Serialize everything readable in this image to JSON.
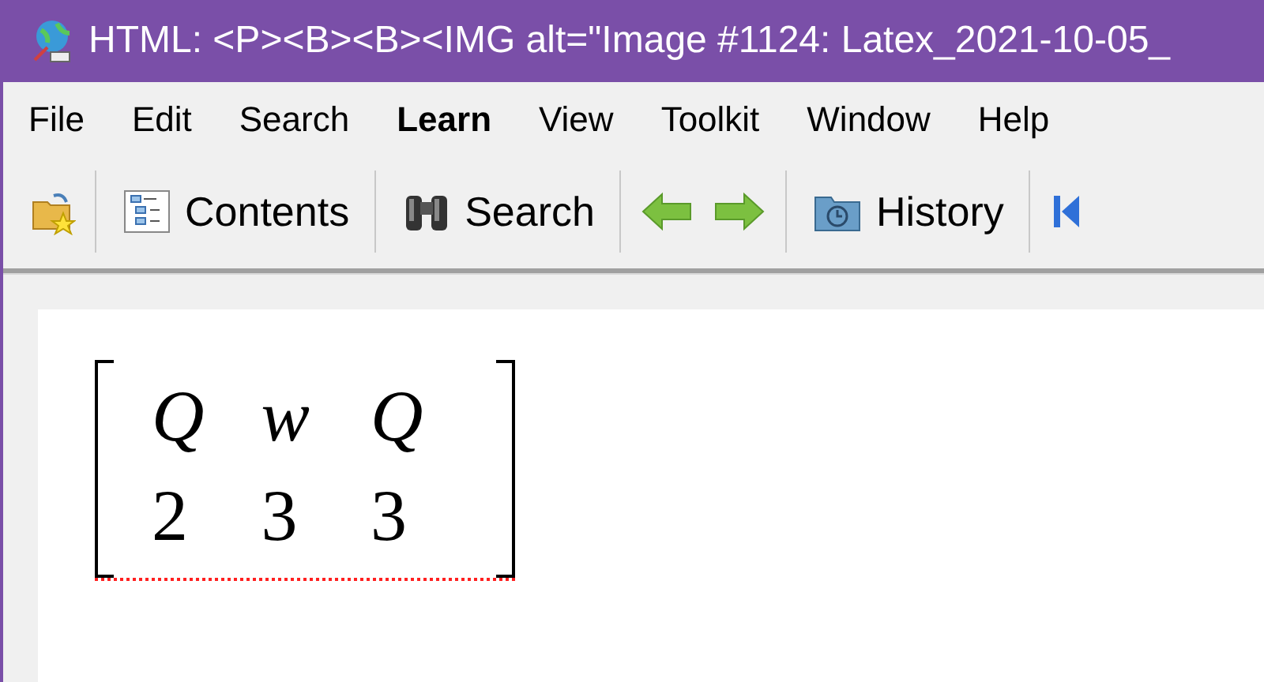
{
  "window": {
    "title": "HTML: <P><B><B><IMG alt=\"Image #1124: Latex_2021-10-05_"
  },
  "menu": [
    {
      "label": "File",
      "bold": false
    },
    {
      "label": "Edit",
      "bold": false
    },
    {
      "label": "Search",
      "bold": false
    },
    {
      "label": "Learn",
      "bold": true
    },
    {
      "label": "View",
      "bold": false
    },
    {
      "label": "Toolkit",
      "bold": false
    },
    {
      "label": "Window",
      "bold": false
    },
    {
      "label": "Help",
      "bold": false
    }
  ],
  "toolbar": [
    {
      "kind": "open"
    },
    {
      "kind": "sep"
    },
    {
      "kind": "contents",
      "label": "Contents"
    },
    {
      "kind": "sep"
    },
    {
      "kind": "search",
      "label": "Search"
    },
    {
      "kind": "sep"
    },
    {
      "kind": "back"
    },
    {
      "kind": "forward"
    },
    {
      "kind": "sep"
    },
    {
      "kind": "history",
      "label": "History"
    },
    {
      "kind": "sep"
    },
    {
      "kind": "first"
    }
  ],
  "matrix": {
    "rows": [
      [
        "Q",
        "w",
        "Q"
      ],
      [
        "2",
        "3",
        "3"
      ]
    ]
  }
}
